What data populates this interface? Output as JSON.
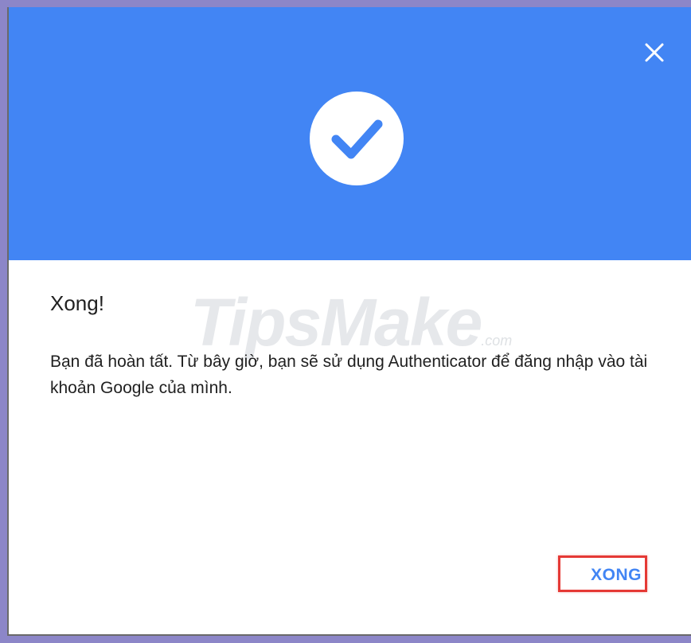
{
  "dialog": {
    "title": "Xong!",
    "message": "Bạn đã hoàn tất. Từ bây giờ, bạn sẽ sử dụng Authenticator để đăng nhập vào tài khoản Google của mình.",
    "done_label": "XONG",
    "close_icon": "close-icon",
    "success_icon": "checkmark-icon"
  },
  "watermark": {
    "brand": "TipsMake",
    "suffix": ".com"
  },
  "colors": {
    "header_bg": "#4285f4",
    "accent": "#4285f4",
    "highlight_border": "#e53935"
  }
}
